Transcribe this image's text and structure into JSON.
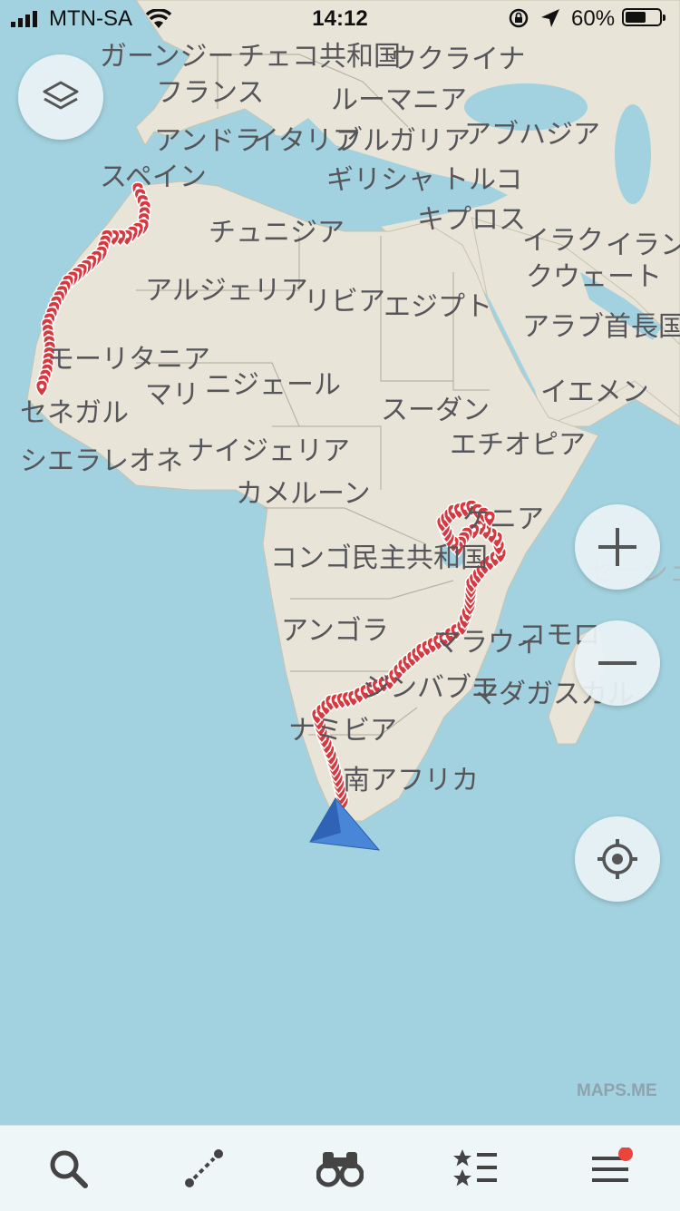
{
  "status_bar": {
    "carrier": "MTN-SA",
    "time": "14:12",
    "battery_percent": "60%",
    "battery_level": 0.6,
    "icons": [
      "signal-icon",
      "wifi-icon",
      "rotation-lock-icon",
      "location-arrow-icon",
      "battery-icon"
    ]
  },
  "map": {
    "colors": {
      "water": "#a2d2df",
      "land": "#e8e5d8",
      "border": "#b8b4a4",
      "route": "#d63a40",
      "position": "#3b78d0"
    },
    "labels": {
      "garnsey": "ガーンジー",
      "czech": "チェコ共和国",
      "ukraine": "ウクライナ",
      "france": "フランス",
      "romania": "ルーマニア",
      "andorra": "アンドラ",
      "italy": "イタリア",
      "bulgaria": "ブルガリア",
      "abkhazia": "アブハジア",
      "spain": "スペイン",
      "greece": "ギリシャ",
      "turkey": "トルコ",
      "cyprus": "キプロス",
      "tunisia": "チュニジア",
      "iraq": "イラク",
      "iran": "イラン",
      "kuwait": "クウェート",
      "algeria": "アルジェリア",
      "libya": "リビア",
      "egypt": "エジプト",
      "uae": "アラブ首長国",
      "mauritania": "モーリタニア",
      "mali": "マリ",
      "niger": "ニジェール",
      "senegal": "セネガル",
      "sudan": "スーダン",
      "yemen": "イエメン",
      "sierra_leone": "シエラレオネ",
      "nigeria": "ナイジェリア",
      "ethiopia": "エチオピア",
      "cameroon": "カメルーン",
      "kenya": "ケニア",
      "drc": "コンゴ民主共和国",
      "seychelles": "セーシェ",
      "angola": "アンゴラ",
      "comoros": "コモロ",
      "malawi": "マラウィ",
      "zimbabwe": "ジンバブエ",
      "madagascar": "マダガスカル",
      "namibia": "ナミビア",
      "south_africa": "南アフリカ"
    }
  },
  "controls": {
    "layers": "layers-icon",
    "zoom_in": "plus-icon",
    "zoom_out": "minus-icon",
    "my_position": "crosshair-icon"
  },
  "watermark": "MAPS.ME",
  "bottom_bar": {
    "tabs": [
      "search-icon",
      "route-icon",
      "discovery-binoculars-icon",
      "bookmarks-icon",
      "menu-icon"
    ],
    "menu_badge": true
  }
}
